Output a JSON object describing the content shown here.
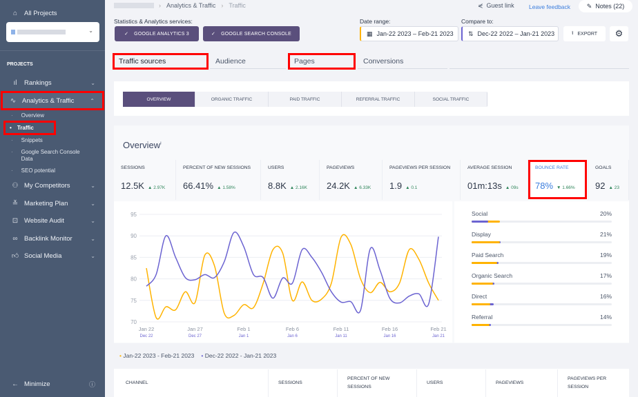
{
  "sidebar": {
    "all_projects": "All Projects",
    "section": "PROJECTS",
    "items": [
      {
        "label": "Rankings",
        "icon": "bar-chart-icon"
      },
      {
        "label": "Analytics & Traffic",
        "icon": "pulse-icon"
      },
      {
        "label": "My Competitors",
        "icon": "users-icon"
      },
      {
        "label": "Marketing Plan",
        "icon": "checklist-icon"
      },
      {
        "label": "Website Audit",
        "icon": "search-square-icon"
      },
      {
        "label": "Backlink Monitor",
        "icon": "link-icon"
      },
      {
        "label": "Social Media",
        "icon": "thumbs-up-icon"
      }
    ],
    "subitems": [
      "Overview",
      "Traffic",
      "Snippets",
      "Google Search Console Data",
      "SEO potential"
    ],
    "minimize": "Minimize"
  },
  "header": {
    "breadcrumb": [
      "Analytics & Traffic",
      "Traffic"
    ],
    "guest_link": "Guest link",
    "leave_feedback": "Leave feedback",
    "notes": "Notes (22)",
    "services_label": "Statistics & Analytics services:",
    "services": [
      "GOOGLE ANALYTICS 3",
      "GOOGLE SEARCH CONSOLE"
    ],
    "date_range_label": "Date range:",
    "date_range": "Jan-22 2023 – Feb-21 2023",
    "compare_label": "Compare to:",
    "compare": "Dec-22 2022 – Jan-21 2023",
    "export": "EXPORT"
  },
  "tabs": [
    "Traffic sources",
    "Audience",
    "Pages",
    "Conversions"
  ],
  "segments": [
    "OVERVIEW",
    "ORGANIC TRAFFIC",
    "PAID TRAFFIC",
    "REFERRAL TRAFFIC",
    "SOCIAL TRAFFIC"
  ],
  "overview_title": "Overview",
  "metrics": [
    {
      "label": "SESSIONS",
      "value": "12.5K",
      "delta": "▲ 2.97K"
    },
    {
      "label": "PERCENT OF NEW SESSIONS",
      "value": "66.41%",
      "delta": "▲ 1.58%"
    },
    {
      "label": "USERS",
      "value": "8.8K",
      "delta": "▲ 2.16K"
    },
    {
      "label": "PAGEVIEWS",
      "value": "24.2K",
      "delta": "▲ 6.33K"
    },
    {
      "label": "PAGEVIEWS PER SESSION",
      "value": "1.9",
      "delta": "▲ 0.1"
    },
    {
      "label": "AVERAGE SESSION",
      "value": "01m:13s",
      "delta": "▲ 09s"
    },
    {
      "label": "BOUNCE RATE",
      "value": "78%",
      "delta": "▼ 1.66%"
    },
    {
      "label": "GOALS",
      "value": "92",
      "delta": "▲ 23"
    }
  ],
  "colors": {
    "current": "#ffb300",
    "previous": "#6b63d1",
    "accent": "#5a4f7c",
    "link": "#3b7ddd"
  },
  "chart_data": {
    "type": "line",
    "ylim": [
      70,
      95
    ],
    "yticks": [
      "70",
      "75",
      "80",
      "85",
      "90",
      "95"
    ],
    "xticks": [
      "Jan 22",
      "Jan 27",
      "Feb 1",
      "Feb 6",
      "Feb 11",
      "Feb 16",
      "Feb 21"
    ],
    "xticks_compare": [
      "Dec 22",
      "Dec 27",
      "Jan 1",
      "Jan 6",
      "Jan 11",
      "Jan 16",
      "Jan 21"
    ],
    "grid": true,
    "legend": "bottom-left",
    "series": [
      {
        "name": "Jan-22 2023 - Feb-21 2023",
        "values": [
          82.5,
          71,
          73.5,
          72.8,
          77,
          74.5,
          85.5,
          83,
          72,
          71.5,
          74,
          73.3,
          79,
          86.8,
          86,
          75,
          79.3,
          75,
          75.3,
          79,
          89.7,
          88,
          80,
          76.8,
          79.2,
          77,
          79,
          86.8,
          84.5,
          79,
          75
        ]
      },
      {
        "name": "Dec-22 2022 - Jan-21 2023",
        "values": [
          78.3,
          81,
          90,
          85,
          80.3,
          79.8,
          81,
          80.3,
          84,
          90.8,
          87.5,
          81,
          80.3,
          75.5,
          80.2,
          79,
          86.8,
          85,
          81.5,
          77,
          74.6,
          74.7,
          72.7,
          87,
          82,
          75.5,
          74.4,
          76,
          76.5,
          74.2,
          89.8
        ]
      }
    ]
  },
  "sources": [
    {
      "name": "Social",
      "pct": "20%",
      "current_bar": 20,
      "previous_bar": 12
    },
    {
      "name": "Display",
      "pct": "21%",
      "current_bar": 20,
      "previous_bar": 20.8
    },
    {
      "name": "Paid Search",
      "pct": "19%",
      "current_bar": 18,
      "previous_bar": 19
    },
    {
      "name": "Organic Search",
      "pct": "17%",
      "current_bar": 15.5,
      "previous_bar": 16.3
    },
    {
      "name": "Direct",
      "pct": "16%",
      "current_bar": 13.3,
      "previous_bar": 16
    },
    {
      "name": "Referral",
      "pct": "14%",
      "current_bar": 13,
      "previous_bar": 13.8
    }
  ],
  "table": {
    "headers": [
      "CHANNEL",
      "SESSIONS",
      "PERCENT OF NEW SESSIONS",
      "USERS",
      "PAGEVIEWS",
      "PAGEVIEWS PER SESSION"
    ]
  }
}
